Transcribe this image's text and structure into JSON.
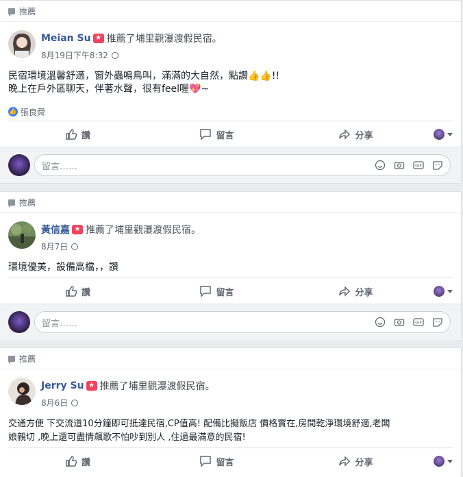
{
  "posts": [
    {
      "tag": "推薦",
      "author": "Meian Su",
      "action": "推薦了埔里觀瀑渡假民宿。",
      "date": "8月19日下午8:32",
      "lines": [
        "民宿環境溫馨舒適，窗外蟲鳴鳥叫，滿滿的大自然，點讚👍👍!!",
        "晚上在戶外區聊天，伴著水聲，很有feel喔💖~"
      ],
      "liked_by": "張良舜",
      "actions": {
        "like": "讚",
        "comment": "留言",
        "share": "分享"
      },
      "comment_placeholder": "留言……"
    },
    {
      "tag": "推薦",
      "author": "黃信嘉",
      "action": "推薦了埔里觀瀑渡假民宿。",
      "date": "8月7日",
      "lines": [
        "環境優美，設備高檔，，讚"
      ],
      "actions": {
        "like": "讚",
        "comment": "留言",
        "share": "分享"
      },
      "comment_placeholder": "留言……"
    },
    {
      "tag": "推薦",
      "author": "Jerry Su",
      "action": "推薦了埔里觀瀑渡假民宿。",
      "date": "8月6日",
      "lines": [
        "交通方便 下交流道10分鐘即可抵達民宿,CP值高! 配備比擬飯店 價格實在,房間乾淨環境舒適,老闆",
        "娘親切 ,晚上還可盡情飆歌不怕吵到別人 ,住過最滿意的民宿!"
      ],
      "actions": {
        "like": "讚",
        "comment": "留言",
        "share": "分享"
      }
    }
  ],
  "icons": {
    "tag": "speech-bubble-icon",
    "like": "thumbs-up-icon",
    "comment": "comment-icon",
    "share": "share-arrow-icon",
    "globe": "globe-icon"
  },
  "colors": {
    "link": "#385898",
    "badge": "#f3425f",
    "like": "#4080ff"
  }
}
